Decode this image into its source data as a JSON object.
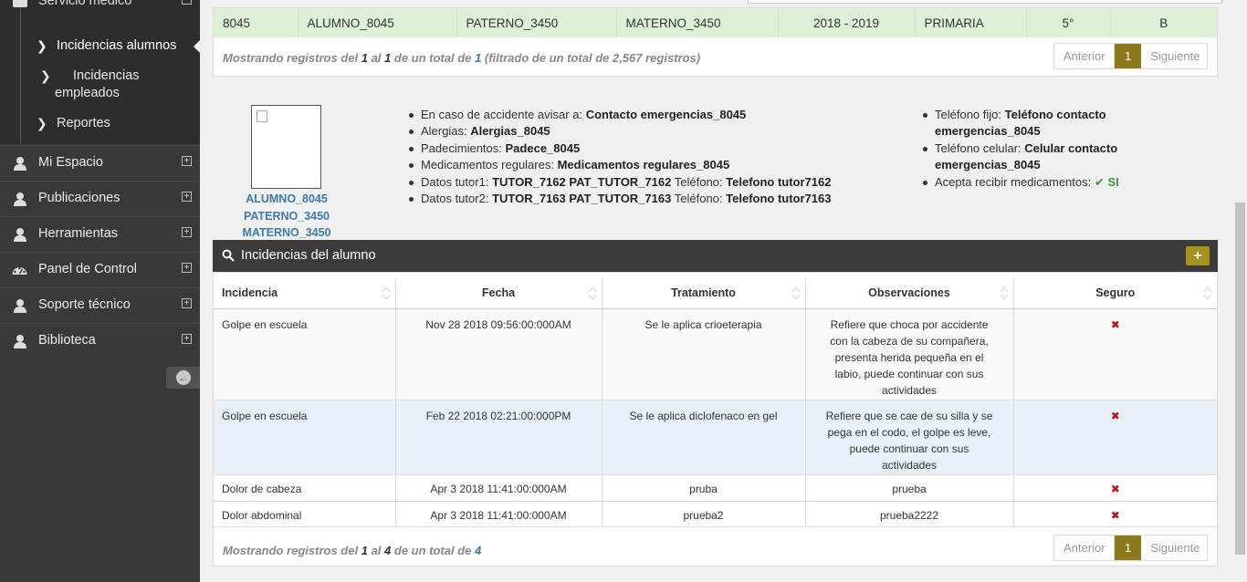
{
  "sidebar": {
    "section_title": "Servicio médico",
    "sub_items": [
      {
        "label": "Incidencias alumnos"
      },
      {
        "label": "Incidencias empleados"
      },
      {
        "label": "Reportes"
      }
    ],
    "items": [
      {
        "label": "Mi Espacio",
        "icon": "user-icon"
      },
      {
        "label": "Publicaciones",
        "icon": "user-icon"
      },
      {
        "label": "Herramientas",
        "icon": "user-icon"
      },
      {
        "label": "Panel de Control",
        "icon": "dashboard-icon"
      },
      {
        "label": "Soporte técnico",
        "icon": "user-icon"
      },
      {
        "label": "Biblioteca",
        "icon": "user-icon"
      }
    ]
  },
  "students_table": {
    "row": [
      "8045",
      "ALUMNO_8045",
      "PATERNO_3450",
      "MATERNO_3450",
      "2018 - 2019",
      "PRIMARIA",
      "5°",
      "B"
    ],
    "info": {
      "prefix": "Mostrando registros del",
      "from": "1",
      "to_word": "al",
      "to": "1",
      "total_word": "de un total de",
      "total": "1",
      "filtered": "(filtrado de un total de 2,567 registros)"
    },
    "pager": {
      "prev": "Anterior",
      "current": "1",
      "next": "Siguiente"
    }
  },
  "student": {
    "name_lines": [
      "ALUMNO_8045",
      "PATERNO_3450",
      "MATERNO_3450"
    ],
    "details_left": [
      {
        "label": "En caso de accidente avisar a:",
        "value": "Contacto emergencias_8045"
      },
      {
        "label": "Alergias:",
        "value": "Alergias_8045"
      },
      {
        "label": "Padecimientos:",
        "value": "Padece_8045"
      },
      {
        "label": "Medicamentos regulares:",
        "value": "Medicamentos regulares_8045"
      },
      {
        "label": "Datos tutor1:",
        "value": "TUTOR_7162 PAT_TUTOR_7162",
        "label2": "Teléfono:",
        "value2": "Telefono tutor7162"
      },
      {
        "label": "Datos tutor2:",
        "value": "TUTOR_7163 PAT_TUTOR_7163",
        "label2": "Teléfono:",
        "value2": "Telefono tutor7163"
      }
    ],
    "details_right": {
      "fixed_label": "Teléfono fijo:",
      "fixed_value_1": "Teléfono contacto",
      "fixed_value_2": "emergencias_8045",
      "cell_label": "Teléfono celular:",
      "cell_value_1": "Celular contacto",
      "cell_value_2": "emergencias_8045",
      "meds_label": "Acepta recibir medicamentos:",
      "meds_value": "SI"
    }
  },
  "incidents": {
    "title": "Incidencias del alumno",
    "add_label": "+",
    "columns": [
      "Incidencia",
      "Fecha",
      "Tratamiento",
      "Observaciones",
      "Seguro"
    ],
    "rows": [
      {
        "incidencia": "Golpe en escuela",
        "fecha": "Nov 28 2018 09:56:00:000AM",
        "tratamiento": "Se le aplica crioeterapia",
        "observaciones": "Refiere que choca por accidente con la cabeza de su compañera, presenta herida pequeña en el labio, puede continuar con sus actividades",
        "seguro": "✖"
      },
      {
        "incidencia": "Golpe en escuela",
        "fecha": "Feb 22 2018 02:21:00:000PM",
        "tratamiento": "Se le aplica diclofenaco en gel",
        "observaciones": "Refiere que se cae de su silla y se pega en el codo, el golpe es leve, puede continuar con sus actividades",
        "seguro": "✖"
      },
      {
        "incidencia": "Dolor de cabeza",
        "fecha": "Apr 3 2018 11:41:00:000AM",
        "tratamiento": "pruba",
        "observaciones": "prueba",
        "seguro": "✖"
      },
      {
        "incidencia": "Dolor abdominal",
        "fecha": "Apr 3 2018 11:41:00:000AM",
        "tratamiento": "prueba2",
        "observaciones": "prueba2222",
        "seguro": "✖"
      }
    ],
    "info": {
      "prefix": "Mostrando registros del",
      "from": "1",
      "to_word": "al",
      "to": "4",
      "total_word": "de un total de",
      "total": "4"
    },
    "pager": {
      "prev": "Anterior",
      "current": "1",
      "next": "Siguiente"
    }
  },
  "colors": {
    "accent": "#8b7a1c",
    "sidebar_bg": "#3b3838",
    "success_row": "#dff0d8",
    "link_blue": "#3d7aaa",
    "danger": "#b0181b"
  }
}
